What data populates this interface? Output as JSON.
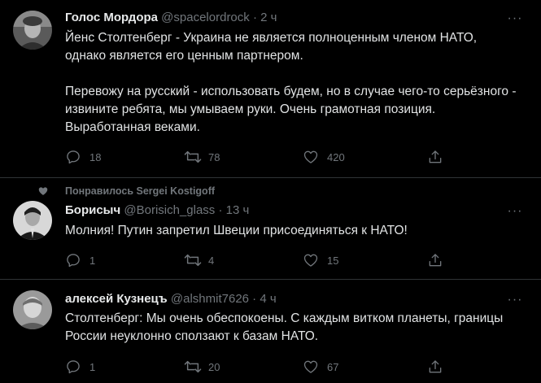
{
  "tweets": [
    {
      "name": "Голос Мордора",
      "handle": "@spacelordrock",
      "separator": "·",
      "time": "2 ч",
      "more": "···",
      "paragraphs": [
        "Йенс Столтенберг - Украина не является полноценным членом НАТО, однако является его ценным партнером.",
        "Перевожу на русский - использовать будем, но в случае чего-то серьёзного - извините ребята, мы умываем руки. Очень грамотная позиция. Выработанная веками."
      ],
      "replies": "18",
      "retweets": "78",
      "likes": "420"
    },
    {
      "social_context": "Понравилось Sergei Kostigoff",
      "name": "Борисыч",
      "handle": "@Borisich_glass",
      "separator": "·",
      "time": "13 ч",
      "more": "···",
      "paragraphs": [
        "Молния! Путин запретил Швеции присоединяться к НАТО!"
      ],
      "replies": "1",
      "retweets": "4",
      "likes": "15"
    },
    {
      "name": "алексей Кузнецъ",
      "handle": "@alshmit7626",
      "separator": "·",
      "time": "4 ч",
      "more": "···",
      "paragraphs": [
        "Столтенберг: Мы очень обеспокоены. С каждым витком планеты, границы России неуклонно сползают к базам НАТО."
      ],
      "replies": "1",
      "retweets": "20",
      "likes": "67"
    }
  ],
  "icons": {
    "reply": "reply-icon",
    "retweet": "retweet-icon",
    "like": "heart-icon",
    "share": "share-icon",
    "liked_by": "heart-small-icon"
  },
  "colors": {
    "background": "#000000",
    "text": "#e1e3e4",
    "secondary": "#71767b",
    "divider": "#2f3336"
  }
}
